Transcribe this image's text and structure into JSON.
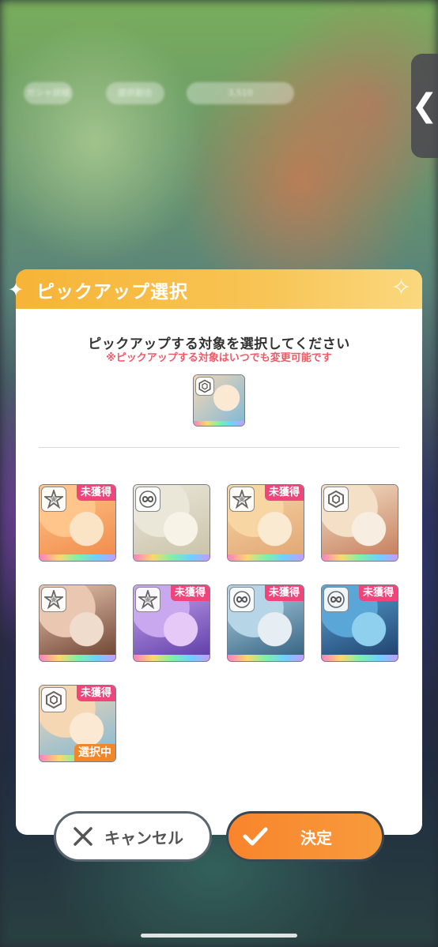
{
  "background": {
    "pills": [
      {
        "label": "ガシャ詳細"
      },
      {
        "label": "提供割合"
      },
      {
        "label": "3,510"
      }
    ]
  },
  "side_tab": {
    "icon": "chevron-left-icon",
    "glyph": "❮"
  },
  "modal": {
    "title": "ピックアップ選択",
    "instruction": "ピックアップする対象を選択してください",
    "note": "※ピックアップする対象はいつでも変更可能です",
    "current_pick_icon": "current-pickup-card"
  },
  "cards": [
    {
      "attr": "star",
      "badge": "未獲得",
      "selected": false,
      "palette": [
        "#ffc58a",
        "#f08a4a",
        "#fbe4c6"
      ]
    },
    {
      "attr": "infinity",
      "badge": "",
      "selected": false,
      "palette": [
        "#eae7d9",
        "#c9c2a8",
        "#f7f3e6"
      ]
    },
    {
      "attr": "star",
      "badge": "未獲得",
      "selected": false,
      "palette": [
        "#f8d6a4",
        "#e0a574",
        "#fbead2"
      ]
    },
    {
      "attr": "cube",
      "badge": "",
      "selected": false,
      "palette": [
        "#f3e0c7",
        "#c47b5a",
        "#f7ede0"
      ]
    },
    {
      "attr": "star",
      "badge": "",
      "selected": false,
      "palette": [
        "#e9c7b0",
        "#6a3f2e",
        "#f0dccd"
      ]
    },
    {
      "attr": "star",
      "badge": "未獲得",
      "selected": false,
      "palette": [
        "#c9a8f0",
        "#5b3aa6",
        "#e6c9f7"
      ]
    },
    {
      "attr": "infinity",
      "badge": "未獲得",
      "selected": false,
      "palette": [
        "#b6d5e6",
        "#2f5f7e",
        "#e6eef3"
      ]
    },
    {
      "attr": "infinity",
      "badge": "未獲得",
      "selected": false,
      "palette": [
        "#5aa6d6",
        "#1e3e6a",
        "#8fd0ee"
      ]
    },
    {
      "attr": "cube",
      "badge": "未獲得",
      "selected": true,
      "selected_label": "選択中",
      "palette": [
        "#f6d7b4",
        "#7fb8d6",
        "#fbe9d3"
      ]
    }
  ],
  "buttons": {
    "cancel": {
      "label": "キャンセル",
      "icon": "close-icon"
    },
    "confirm": {
      "label": "決定",
      "icon": "checkmark-icon"
    }
  }
}
